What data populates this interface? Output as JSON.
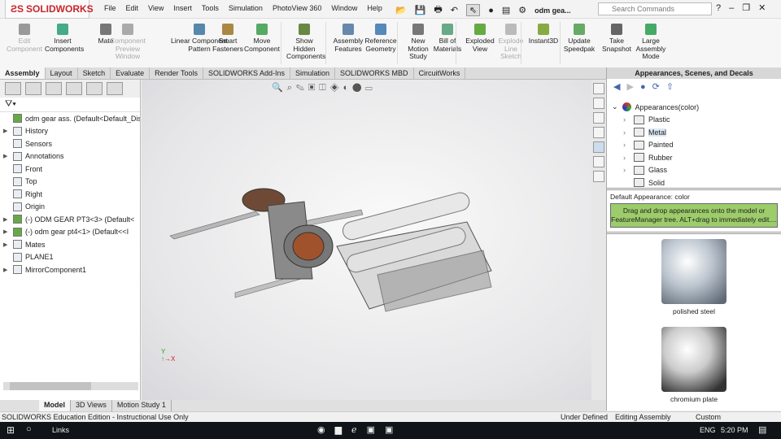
{
  "app": {
    "logo": "SOLIDWORKS",
    "doc_title": "odm gea...",
    "search_placeholder": "Search Commands"
  },
  "menu": [
    "File",
    "Edit",
    "View",
    "Insert",
    "Tools",
    "Simulation",
    "PhotoView 360",
    "Window",
    "Help"
  ],
  "ribbon": [
    {
      "label": "Edit Component",
      "disabled": true
    },
    {
      "label": "Insert Components"
    },
    {
      "label": "Mate"
    },
    {
      "label": "Component Preview Window",
      "disabled": true
    },
    {
      "label": "Linear Component Pattern"
    },
    {
      "label": "Smart Fasteners"
    },
    {
      "label": "Move Component"
    },
    {
      "label": "Show Hidden Components"
    },
    {
      "label": "Assembly Features"
    },
    {
      "label": "Reference Geometry"
    },
    {
      "label": "New Motion Study"
    },
    {
      "label": "Bill of Materials"
    },
    {
      "label": "Exploded View"
    },
    {
      "label": "Explode Line Sketch",
      "disabled": true
    },
    {
      "label": "Instant3D"
    },
    {
      "label": "Update Speedpak"
    },
    {
      "label": "Take Snapshot"
    },
    {
      "label": "Large Assembly Mode"
    }
  ],
  "tabs": [
    "Assembly",
    "Layout",
    "Sketch",
    "Evaluate",
    "Render Tools",
    "SOLIDWORKS Add-Ins",
    "Simulation",
    "SOLIDWORKS MBD",
    "CircuitWorks"
  ],
  "tree": [
    {
      "label": "odm gear ass.  (Default<Default_Disp",
      "arrow": false
    },
    {
      "label": "History",
      "arrow": true
    },
    {
      "label": "Sensors",
      "arrow": false
    },
    {
      "label": "Annotations",
      "arrow": true
    },
    {
      "label": "Front",
      "arrow": false
    },
    {
      "label": "Top",
      "arrow": false
    },
    {
      "label": "Right",
      "arrow": false
    },
    {
      "label": "Origin",
      "arrow": false
    },
    {
      "label": "(-) ODM GEAR PT3<3> (Default<",
      "arrow": true
    },
    {
      "label": "(-) odm gear pt4<1> (Default<<I",
      "arrow": true
    },
    {
      "label": "Mates",
      "arrow": true
    },
    {
      "label": "PLANE1",
      "arrow": false
    },
    {
      "label": "MirrorComponent1",
      "arrow": true
    }
  ],
  "taskpane": {
    "title": "Appearances, Scenes, and Decals",
    "root": "Appearances(color)",
    "folders": [
      "Plastic",
      "Metal",
      "Painted",
      "Rubber",
      "Glass",
      "Solid"
    ],
    "selected": "Metal",
    "default_label": "Default Appearance: color",
    "hint": "Drag and drop appearances onto the model or FeatureManager tree.  ALT+drag to immediately edit....",
    "swatches": [
      "polished steel",
      "chromium plate"
    ]
  },
  "bottom_tabs": [
    "Model",
    "3D Views",
    "Motion Study 1"
  ],
  "status": {
    "left": "SOLIDWORKS Education Edition - Instructional Use Only",
    "state": "Under Defined",
    "mode": "Editing Assembly",
    "units": "Custom"
  },
  "taskbar": {
    "links": "Links",
    "lang": "ENG",
    "time": "5:20 PM"
  },
  "colors": {
    "hint_bg": "#9dcc6a",
    "brand": "#c8252c"
  }
}
